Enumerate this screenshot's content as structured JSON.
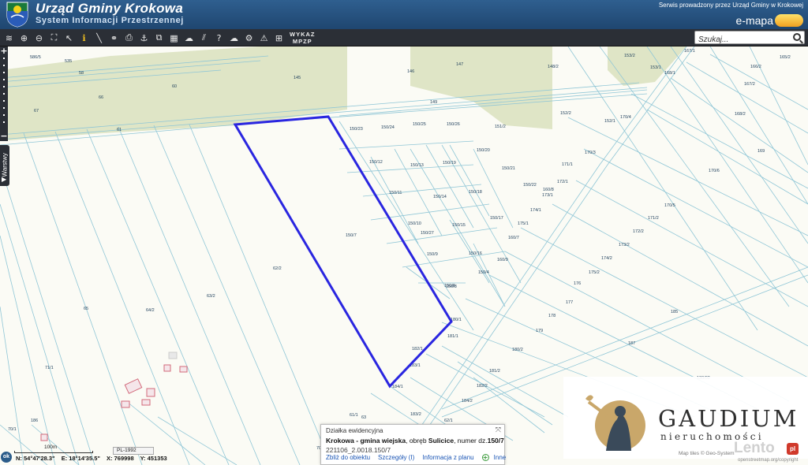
{
  "header": {
    "title": "Urząd Gminy Krokowa",
    "subtitle": "System Informacji Przestrzennej",
    "service_note": "Serwis prowadzony przez Urząd Gminy w Krokowej",
    "brand": "e-mapa"
  },
  "toolbar": {
    "icons": [
      "layers-icon",
      "zoom-in-icon",
      "zoom-out-icon",
      "full-extent-icon",
      "select-arrow-icon",
      "info-icon",
      "measure-line-icon",
      "measure-chain-icon",
      "print-icon",
      "anchor-icon",
      "export-icon",
      "map-view-icon",
      "cloud-icon",
      "hatch-icon",
      "help-icon",
      "cloud-upload-icon",
      "settings-icon",
      "warning-icon",
      "grid-icon"
    ],
    "wykaz_line1": "WYKAZ",
    "wykaz_line2": "MPZP",
    "search_placeholder": "Szukaj..."
  },
  "sidebar": {
    "layers_label": "Warstwy",
    "zoom_in": "+",
    "zoom_out": "−"
  },
  "parcels": {
    "highlighted": "150/7",
    "labels": [
      "586/5",
      "535",
      "58",
      "60",
      "66",
      "67",
      "145",
      "146",
      "147",
      "148/2",
      "153/2",
      "167/1",
      "165/2",
      "153/1",
      "168/1",
      "166/2",
      "167/2",
      "149",
      "61",
      "150/23",
      "150/24",
      "150/25",
      "150/26",
      "151/2",
      "152/2",
      "152/1",
      "170/4",
      "168/2",
      "150/20",
      "150/12",
      "150/13",
      "150/19",
      "150/21",
      "170/3",
      "169",
      "170/6",
      "171/1",
      "172/1",
      "150/22",
      "160/8",
      "173/1",
      "150/11",
      "150/14",
      "150/18",
      "174/1",
      "170/5",
      "150/10",
      "150/15",
      "150/17",
      "175/1",
      "171/2",
      "150/27",
      "172/2",
      "150/9",
      "150/16",
      "160/7",
      "173/2",
      "174/2",
      "62/2",
      "160/9",
      "150/6",
      "150/4",
      "175/2",
      "150/8",
      "176",
      "63/2",
      "64/2",
      "65",
      "177",
      "180/1",
      "178",
      "179",
      "181/1",
      "180/2",
      "182/1",
      "183/1",
      "181/2",
      "184/1",
      "182/2",
      "183/2",
      "184/2",
      "62/1",
      "61/1",
      "63",
      "70/2",
      "71/1",
      "70/1",
      "186",
      "185",
      "187",
      "130/02"
    ]
  },
  "popup": {
    "header": "Działka ewidencyjna",
    "line1_prefix": "Krokowa - gmina wiejska",
    "line1_mid": ", obręb ",
    "line1_obreb": "Sulicice",
    "line1_suffix": ", numer dz.",
    "line1_number": "150/7",
    "line2": "221106_2.0018.150/7",
    "links": [
      "Zbliż do obiektu",
      "Szczegóły (I)",
      "Informacja z planu",
      "Inne"
    ]
  },
  "status": {
    "scale_label": "100m",
    "crs": "PL-1992",
    "ok_label": "ok",
    "lat": "N: 54°47'28.3\"",
    "lon": "E: 18°14'35.5\"",
    "x": "X: 769998",
    "y": "Y: 451353"
  },
  "watermarks": {
    "company": "GAUDIUM",
    "company_sub": "nieruchomości",
    "site": "Lento",
    "site_tld": "pl",
    "credit1": "Map tiles © Geo-System",
    "credit2": "openstreetmap.org/copyright"
  },
  "colors": {
    "header_bg": "#2a557f",
    "toolbar_bg": "#2b2f36",
    "parcel_line": "#8fc6d6",
    "highlight": "#2a26e0",
    "forest": "#dfe5c6",
    "map_bg": "#fbfbf5"
  }
}
